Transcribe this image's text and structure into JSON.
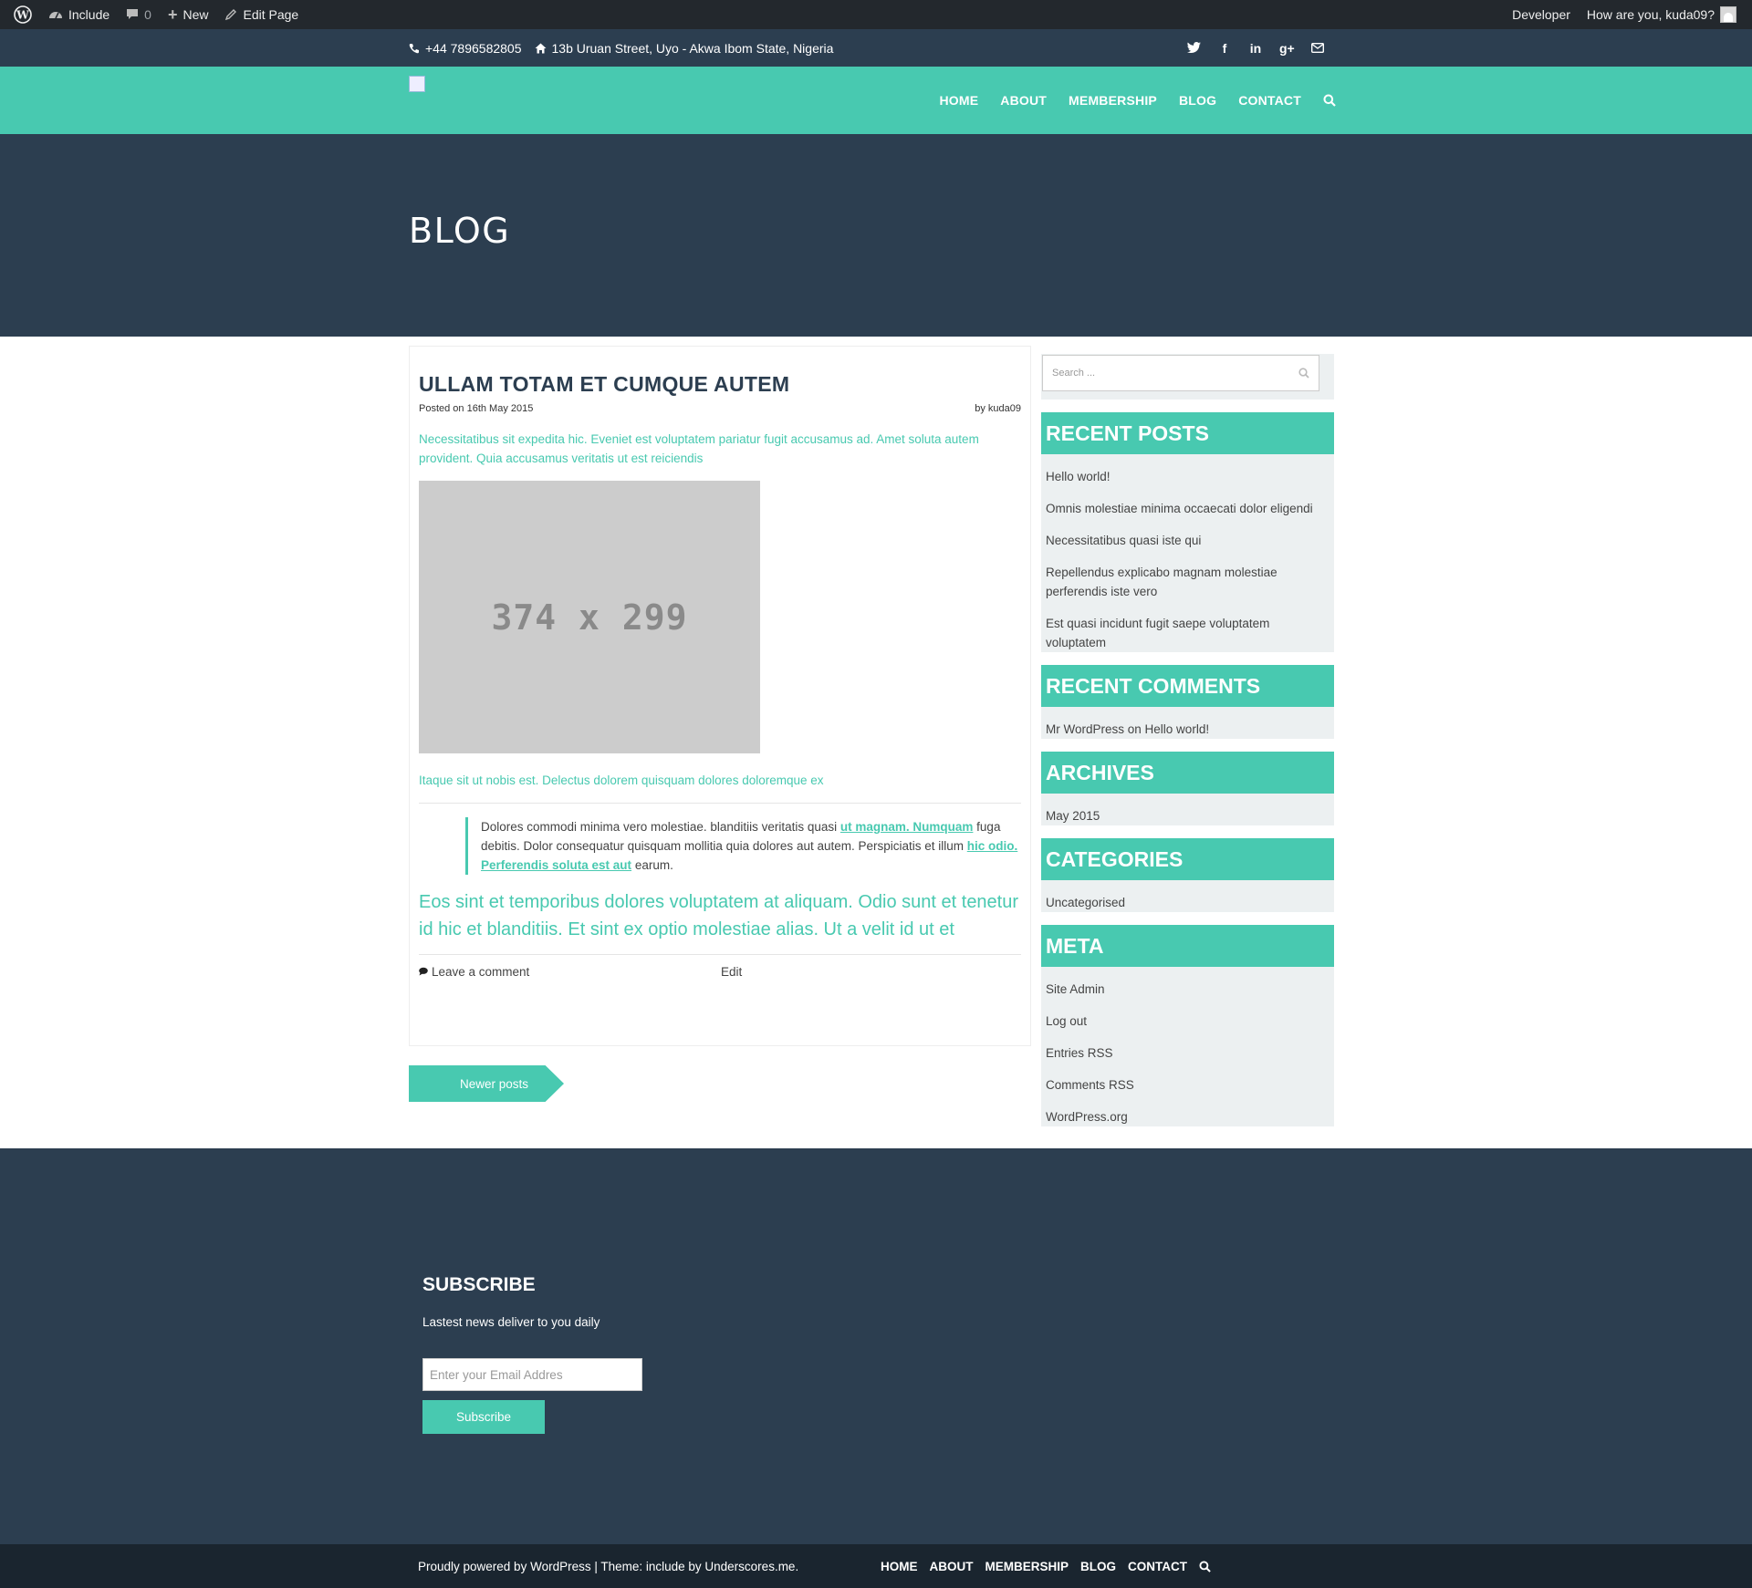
{
  "admin_bar": {
    "site_name": "Include",
    "comments_count": "0",
    "new_label": "New",
    "edit_label": "Edit Page",
    "developer_label": "Developer",
    "greeting": "How are you, kuda09?"
  },
  "topbar": {
    "phone": "+44 7896582805",
    "address": "13b Uruan Street, Uyo - Akwa Ibom State, Nigeria",
    "social_icons": [
      "twitter-icon",
      "facebook-icon",
      "linkedin-icon",
      "google-plus-icon",
      "envelope-icon"
    ]
  },
  "nav": {
    "items": [
      "HOME",
      "ABOUT",
      "MEMBERSHIP",
      "BLOG",
      "CONTACT"
    ]
  },
  "hero": {
    "title": "BLOG"
  },
  "post": {
    "title": "ULLAM TOTAM ET CUMQUE AUTEM",
    "posted_on": "Posted on 16th May 2015",
    "author": "by kuda09",
    "excerpt": "Necessitatibus sit expedita hic. Eveniet est voluptatem pariatur fugit accusamus ad. Amet soluta autem provident. Quia accusamus veritatis ut est reiciendis",
    "image_label": "374 x 299",
    "caption": "Itaque sit ut nobis est. Delectus dolorem quisquam dolores doloremque ex",
    "quote": {
      "text1": "Dolores commodi minima vero molestiae. blanditiis veritatis quasi ",
      "link1": "ut magnam. Numquam",
      "text2": " fuga debitis. Dolor consequatur quisquam mollitia quia dolores aut autem. Perspiciatis et illum ",
      "link2": "hic odio. Perferendis soluta est aut",
      "text3": " earum."
    },
    "lead": "Eos sint et temporibus dolores voluptatem at aliquam. Odio sunt et tenetur id hic et blanditiis. Et sint ex optio molestiae alias. Ut a velit id ut et",
    "comment_link": "Leave a comment",
    "edit_link": "Edit"
  },
  "pagination": {
    "newer": "Newer posts"
  },
  "sidebar": {
    "search_placeholder": "Search ...",
    "recent_posts": {
      "title": "RECENT POSTS",
      "items": [
        "Hello world!",
        "Omnis molestiae minima occaecati dolor eligendi",
        "Necessitatibus quasi iste qui",
        "Repellendus explicabo magnam molestiae perferendis iste vero",
        "Est quasi incidunt fugit saepe voluptatem voluptatem"
      ]
    },
    "recent_comments": {
      "title": "RECENT COMMENTS",
      "author": "Mr WordPress",
      "on": " on ",
      "post": "Hello world!"
    },
    "archives": {
      "title": "ARCHIVES",
      "items": [
        "May 2015"
      ]
    },
    "categories": {
      "title": "CATEGORIES",
      "items": [
        "Uncategorised"
      ]
    },
    "meta": {
      "title": "META",
      "items": [
        "Site Admin",
        "Log out",
        "Entries RSS",
        "Comments RSS",
        "WordPress.org"
      ]
    }
  },
  "footer": {
    "subscribe_title": "SUBSCRIBE",
    "subscribe_text": "Lastest news deliver to you daily",
    "email_placeholder": "Enter your Email Addres",
    "subscribe_button": "Subscribe",
    "powered_text": "Proudly powered by WordPress | Theme: include by Underscores.me.",
    "nav_items": [
      "HOME",
      "ABOUT",
      "MEMBERSHIP",
      "BLOG",
      "CONTACT"
    ]
  },
  "colors": {
    "accent": "#48c9b0",
    "dark": "#2c3e50",
    "admin_bar": "#23282d",
    "bottom_bar": "#1a252f",
    "widget_bg": "#ecf0f1"
  }
}
